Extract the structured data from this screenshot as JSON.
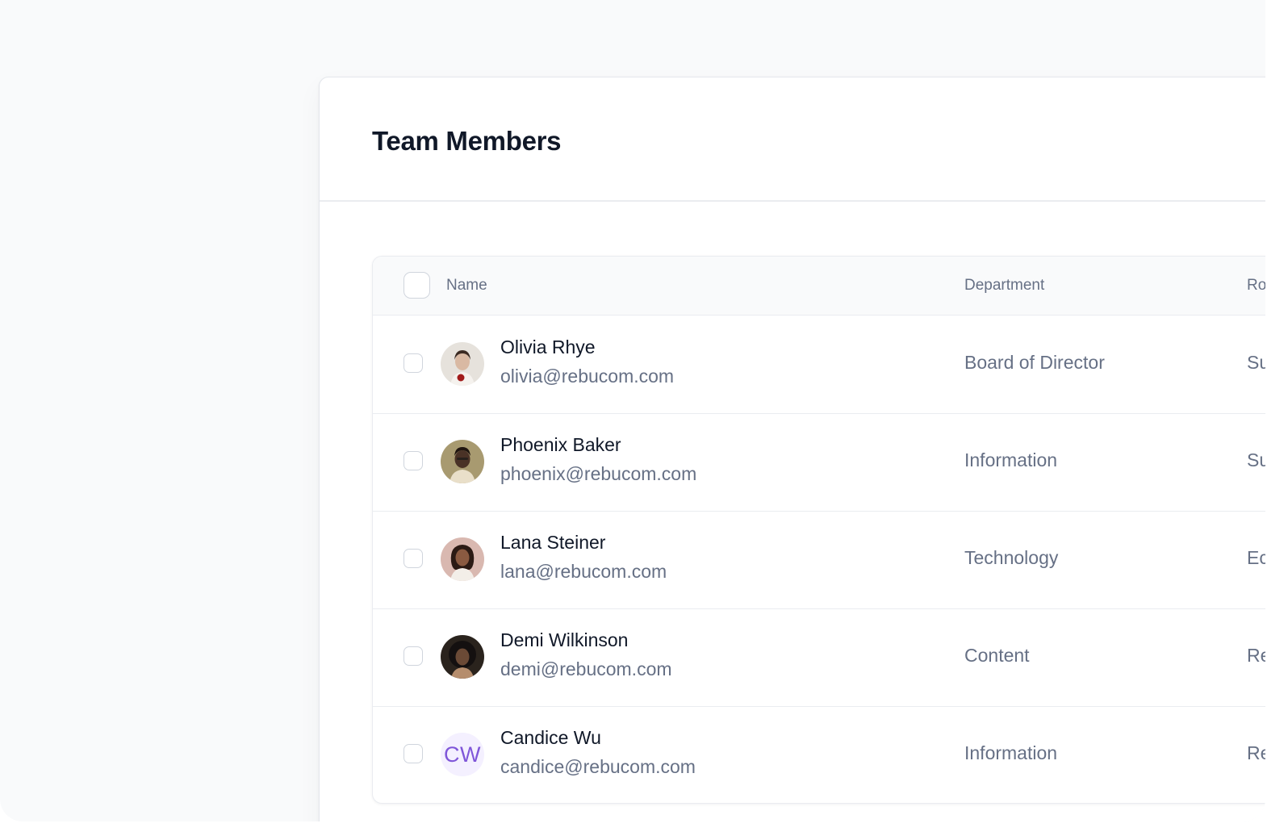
{
  "page": {
    "title": "Team Members"
  },
  "table": {
    "columns": {
      "name": "Name",
      "department": "Department",
      "role": "Ro"
    },
    "rows": [
      {
        "name": "Olivia Rhye",
        "email": "olivia@rebucom.com",
        "department": "Board of Director",
        "role": "Su",
        "avatar": "photo",
        "avatar_colors": [
          "#e8e4df",
          "#3b2a22",
          "#a11b1b"
        ]
      },
      {
        "name": "Phoenix Baker",
        "email": "phoenix@rebucom.com",
        "department": "Information",
        "role": "Su",
        "avatar": "photo",
        "avatar_colors": [
          "#a89a70",
          "#2a1c14",
          "#e9dfc9"
        ]
      },
      {
        "name": "Lana Steiner",
        "email": "lana@rebucom.com",
        "department": "Technology",
        "role": "Ec",
        "avatar": "photo",
        "avatar_colors": [
          "#d9b8b0",
          "#2b1a14",
          "#f3eee8"
        ]
      },
      {
        "name": "Demi Wilkinson",
        "email": "demi@rebucom.com",
        "department": "Content",
        "role": "Re",
        "avatar": "photo",
        "avatar_colors": [
          "#2a231d",
          "#141010",
          "#b58d6d"
        ]
      },
      {
        "name": "Candice Wu",
        "email": "candice@rebucom.com",
        "department": "Information",
        "role": "Re",
        "avatar": "initials",
        "initials": "CW"
      }
    ]
  },
  "colors": {
    "heading": "#101828",
    "muted_text": "#667085",
    "border": "#eaecf0",
    "initials_avatar_bg": "#f4f0ff",
    "initials_avatar_text": "#7f56d9"
  }
}
